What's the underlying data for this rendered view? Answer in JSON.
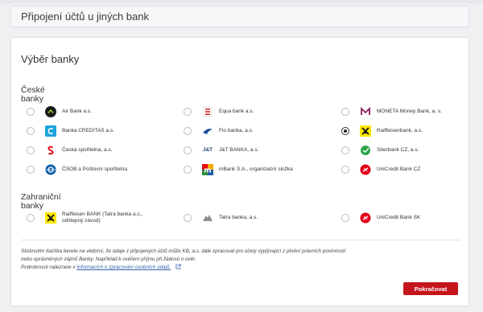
{
  "page": {
    "header_title": "Připojení účtů u jiných bank",
    "section_title": "Výběr banky"
  },
  "groups": {
    "czech_label": "České banky",
    "foreign_label": "Zahraniční banky"
  },
  "czech_banks": [
    {
      "name": "Air Bank a.s.",
      "icon": "air-bank-logo",
      "selected": false
    },
    {
      "name": "Equa bank a.s.",
      "icon": "equa-bank-logo",
      "selected": false
    },
    {
      "name": "MONETA Money Bank, a. s.",
      "icon": "moneta-logo",
      "selected": false
    },
    {
      "name": "Banka CREDITAS a.s.",
      "icon": "creditas-logo",
      "selected": false
    },
    {
      "name": "Fio banka, a.s.",
      "icon": "fio-logo",
      "selected": false
    },
    {
      "name": "Raiffeisenbank, a.s.",
      "icon": "raiffeisen-logo",
      "selected": true
    },
    {
      "name": "Česká spořitelna, a.s.",
      "icon": "ceska-sporitelna-logo",
      "selected": false
    },
    {
      "name": "J&T BANKA, a.s.",
      "icon": "jt-banka-logo",
      "selected": false
    },
    {
      "name": "Sberbank CZ, a.s.",
      "icon": "sberbank-logo",
      "selected": false
    },
    {
      "name": "ČSOB a Poštovní spořitelna",
      "icon": "csob-logo",
      "selected": false
    },
    {
      "name": "mBank S.A., organizační složka",
      "icon": "mbank-logo",
      "selected": false
    },
    {
      "name": "UniCredit Bank CZ",
      "icon": "unicredit-logo",
      "selected": false
    }
  ],
  "foreign_banks": [
    {
      "name": "Raiffeisen BANK (Tatra banka a.s., odštepný závod)",
      "icon": "raiffeisen-logo",
      "selected": false
    },
    {
      "name": "Tatra banka, a.s.",
      "icon": "tatra-banka-logo",
      "selected": false
    },
    {
      "name": "UniCredit Bank SK",
      "icon": "unicredit-logo",
      "selected": false
    }
  ],
  "note": {
    "line1": "Stisknutím tlačítka berete na vědomí, že údaje z připojených účtů může KB, a.s. dále zpracovat pro účely vyplývající z plnění právních povinností",
    "line2": "nebo oprávněných zájmů Banky. Například k ověření příjmu při žádosti o úvěr.",
    "line3_prefix": "Podrobnosti naleznete v",
    "link_text": "Informacích o zpracování osobních údajů."
  },
  "actions": {
    "continue_label": "Pokračovat"
  },
  "colors": {
    "accent": "#c4151c",
    "link": "#2f5fa8"
  }
}
